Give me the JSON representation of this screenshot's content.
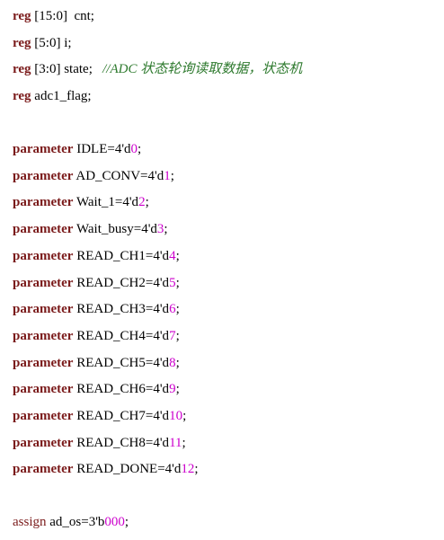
{
  "lines": [
    {
      "kw": "reg",
      "text": " [15:0]  cnt;"
    },
    {
      "kw": "reg",
      "text": " [5:0] i;"
    },
    {
      "kw": "reg",
      "text": " [3:0] state;   ",
      "comment": "//ADC 状态轮询读取数据，状态机"
    },
    {
      "kw": "reg",
      "text": " adc1_flag;"
    },
    {
      "kw": "parameter",
      "text": " IDLE=4'd",
      "num": "0",
      "end": ";"
    },
    {
      "kw": "parameter",
      "text": " AD_CONV=4'd",
      "num": "1",
      "end": ";"
    },
    {
      "kw": "parameter",
      "text": " Wait_1=4'd",
      "num": "2",
      "end": ";"
    },
    {
      "kw": "parameter",
      "text": " Wait_busy=4'd",
      "num": "3",
      "end": ";"
    },
    {
      "kw": "parameter",
      "text": " READ_CH1=4'd",
      "num": "4",
      "end": ";"
    },
    {
      "kw": "parameter",
      "text": " READ_CH2=4'd",
      "num": "5",
      "end": ";"
    },
    {
      "kw": "parameter",
      "text": " READ_CH3=4'd",
      "num": "6",
      "end": ";"
    },
    {
      "kw": "parameter",
      "text": " READ_CH4=4'd",
      "num": "7",
      "end": ";"
    },
    {
      "kw": "parameter",
      "text": " READ_CH5=4'd",
      "num": "8",
      "end": ";"
    },
    {
      "kw": "parameter",
      "text": " READ_CH6=4'd",
      "num": "9",
      "end": ";"
    },
    {
      "kw": "parameter",
      "text": " READ_CH7=4'd",
      "num": "10",
      "end": ";"
    },
    {
      "kw": "parameter",
      "text": " READ_CH8=4'd",
      "num": "11",
      "end": ";"
    },
    {
      "kw": "parameter",
      "text": " READ_DONE=4'd",
      "num": "12",
      "end": ";"
    },
    {
      "kw": "assign",
      "text": " ad_os=3'b",
      "num": "000",
      "end": ";"
    }
  ],
  "colors": {
    "keyword": "#7a1a1a",
    "number": "#cc00cc",
    "comment": "#2e7a2e",
    "text": "#000000",
    "background": "#ffffff"
  }
}
